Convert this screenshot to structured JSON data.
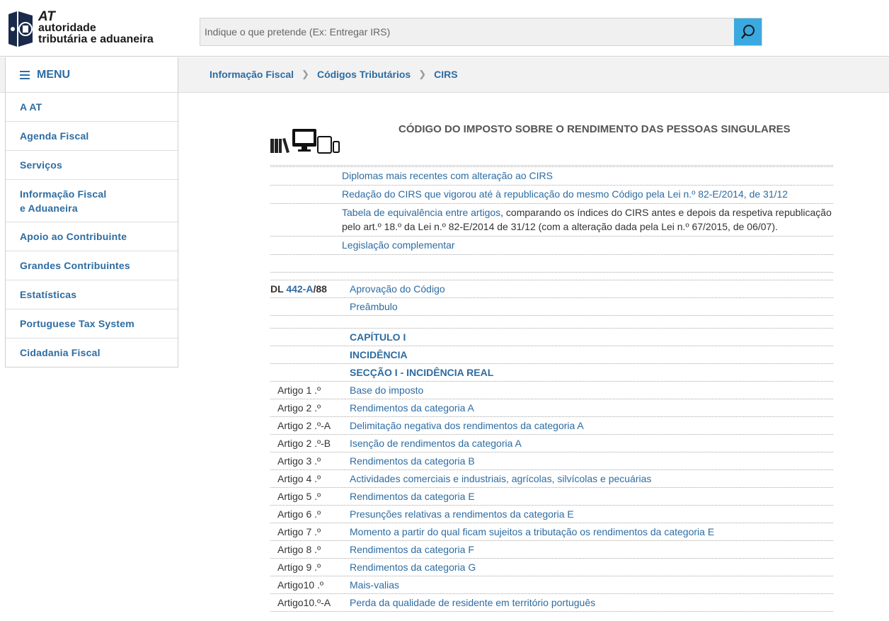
{
  "header": {
    "logo": {
      "line1": "AT",
      "line2": "autoridade",
      "line3": "tributária e aduaneira"
    },
    "search": {
      "placeholder": "Indique o que pretende (Ex: Entregar IRS)"
    }
  },
  "sidebar": {
    "menu_label": "MENU",
    "items": [
      {
        "label": "A AT"
      },
      {
        "label": "Agenda Fiscal"
      },
      {
        "label": "Serviços"
      },
      {
        "label": "Informação Fiscal e Aduaneira"
      },
      {
        "label": "Apoio ao Contribuinte"
      },
      {
        "label": "Grandes Contribuintes"
      },
      {
        "label": "Estatísticas"
      },
      {
        "label": "Portuguese Tax System"
      },
      {
        "label": "Cidadania Fiscal"
      }
    ]
  },
  "breadcrumb": {
    "items": [
      {
        "label": "Informação Fiscal"
      },
      {
        "label": "Códigos Tributários"
      },
      {
        "label": "CIRS"
      }
    ]
  },
  "main": {
    "title": "CÓDIGO DO IMPOSTO SOBRE O RENDIMENTO DAS PESSOAS SINGULARES",
    "top_links": [
      {
        "link": "Diplomas mais recentes com alteração ao CIRS",
        "text": ""
      },
      {
        "link": "Redação do CIRS que vigorou até à republicação do mesmo Código pela Lei n.º 82-E/2014, de 31/12",
        "text": ""
      },
      {
        "link": "Tabela de equivalência entre artigos",
        "text": ", comparando os índices do CIRS antes e depois da respetiva republicação pelo art.º 18.º da Lei n.º 82-E/2014 de 31/12 (com a alteração dada pela Lei n.º 67/2015, de 06/07)."
      },
      {
        "link": "Legislação complementar",
        "text": ""
      }
    ],
    "dl": {
      "prefix": "DL ",
      "number": "442-A",
      "suffix": "/88"
    },
    "dl_rows": [
      {
        "label": "Aprovação do Código"
      },
      {
        "label": "Preâmbulo"
      }
    ],
    "headings": [
      {
        "label": "CAPÍTULO I"
      },
      {
        "label": "INCIDÊNCIA"
      },
      {
        "label": "SECÇÃO I - INCIDÊNCIA REAL"
      }
    ],
    "articles": [
      {
        "num": "Artigo 1 .º",
        "title": "Base do imposto"
      },
      {
        "num": "Artigo 2 .º",
        "title": "Rendimentos da categoria A"
      },
      {
        "num": "Artigo 2 .º-A",
        "title": "Delimitação negativa dos rendimentos da categoria A"
      },
      {
        "num": "Artigo 2 .º-B",
        "title": "Isenção de rendimentos da categoria A"
      },
      {
        "num": "Artigo 3 .º",
        "title": "Rendimentos da categoria B"
      },
      {
        "num": "Artigo 4 .º",
        "title": "Actividades comerciais e industriais, agrícolas, silvícolas e pecuárias"
      },
      {
        "num": "Artigo 5 .º",
        "title": "Rendimentos da categoria E"
      },
      {
        "num": "Artigo 6 .º",
        "title": "Presunções relativas a rendimentos da categoria E"
      },
      {
        "num": "Artigo 7 .º",
        "title": "Momento a partir do qual ficam sujeitos a tributação os rendimentos da categoria E"
      },
      {
        "num": "Artigo 8 .º",
        "title": "Rendimentos da categoria F"
      },
      {
        "num": "Artigo 9 .º",
        "title": "Rendimentos da categoria G"
      },
      {
        "num": "Artigo10 .º",
        "title": "Mais-valias"
      },
      {
        "num": "Artigo10.º-A",
        "title": "Perda da qualidade de residente em território português"
      }
    ]
  },
  "colors": {
    "link": "#2d6ca2",
    "search_button": "#3aa9e0",
    "band": "#f2f2f2"
  }
}
